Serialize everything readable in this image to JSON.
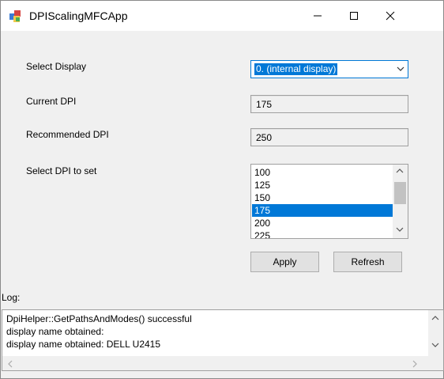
{
  "window": {
    "title": "DPIScalingMFCApp"
  },
  "form": {
    "select_display_label": "Select Display",
    "select_display_value": "0. (internal display)",
    "current_dpi_label": "Current DPI",
    "current_dpi_value": "175",
    "recommended_dpi_label": "Recommended DPI",
    "recommended_dpi_value": "250",
    "select_dpi_label": "Select DPI to set",
    "dpi_options": [
      "100",
      "125",
      "150",
      "175",
      "200",
      "225"
    ],
    "dpi_selected": "175",
    "apply_label": "Apply",
    "refresh_label": "Refresh"
  },
  "log": {
    "label": "Log:",
    "lines": [
      "DpiHelper::GetPathsAndModes() successful",
      "display name obtained:",
      "display name obtained: DELL U2415"
    ]
  },
  "colors": {
    "accent": "#0078d7",
    "window_bg": "#f0f0f0",
    "titlebar_bg": "#ffffff"
  },
  "icons": [
    "app-icon",
    "minimize-icon",
    "maximize-icon",
    "close-icon",
    "chevron-down-icon",
    "scroll-up-icon",
    "scroll-down-icon",
    "scroll-left-icon",
    "scroll-right-icon"
  ]
}
